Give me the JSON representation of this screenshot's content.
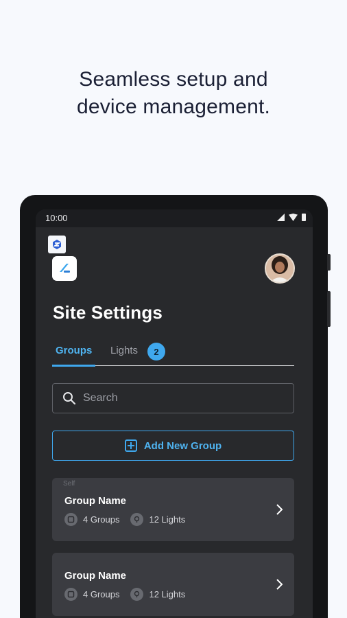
{
  "headline": {
    "line1": "Seamless setup and",
    "line2": "device management."
  },
  "statusbar": {
    "time": "10:00"
  },
  "page": {
    "title": "Site Settings"
  },
  "tabs": [
    {
      "label": "Groups",
      "active": true
    },
    {
      "label": "Lights",
      "badge": "2",
      "active": false
    }
  ],
  "search": {
    "placeholder": "Search",
    "value": ""
  },
  "add_group": {
    "label": "Add New Group"
  },
  "groups": [
    {
      "tag": "Self",
      "name": "Group Name",
      "groups_count": "4 Groups",
      "lights_count": "12 Lights"
    },
    {
      "tag": "",
      "name": "Group Name",
      "groups_count": "4 Groups",
      "lights_count": "12 Lights"
    }
  ],
  "colors": {
    "accent": "#3fa8ee",
    "background": "#f7f9fd",
    "screen": "#28292c",
    "card": "#3b3c41"
  },
  "icons": [
    "signal-icon",
    "wifi-icon",
    "battery-icon",
    "search-icon",
    "add-icon",
    "group-icon",
    "bulb-icon",
    "chevron-right-icon"
  ]
}
